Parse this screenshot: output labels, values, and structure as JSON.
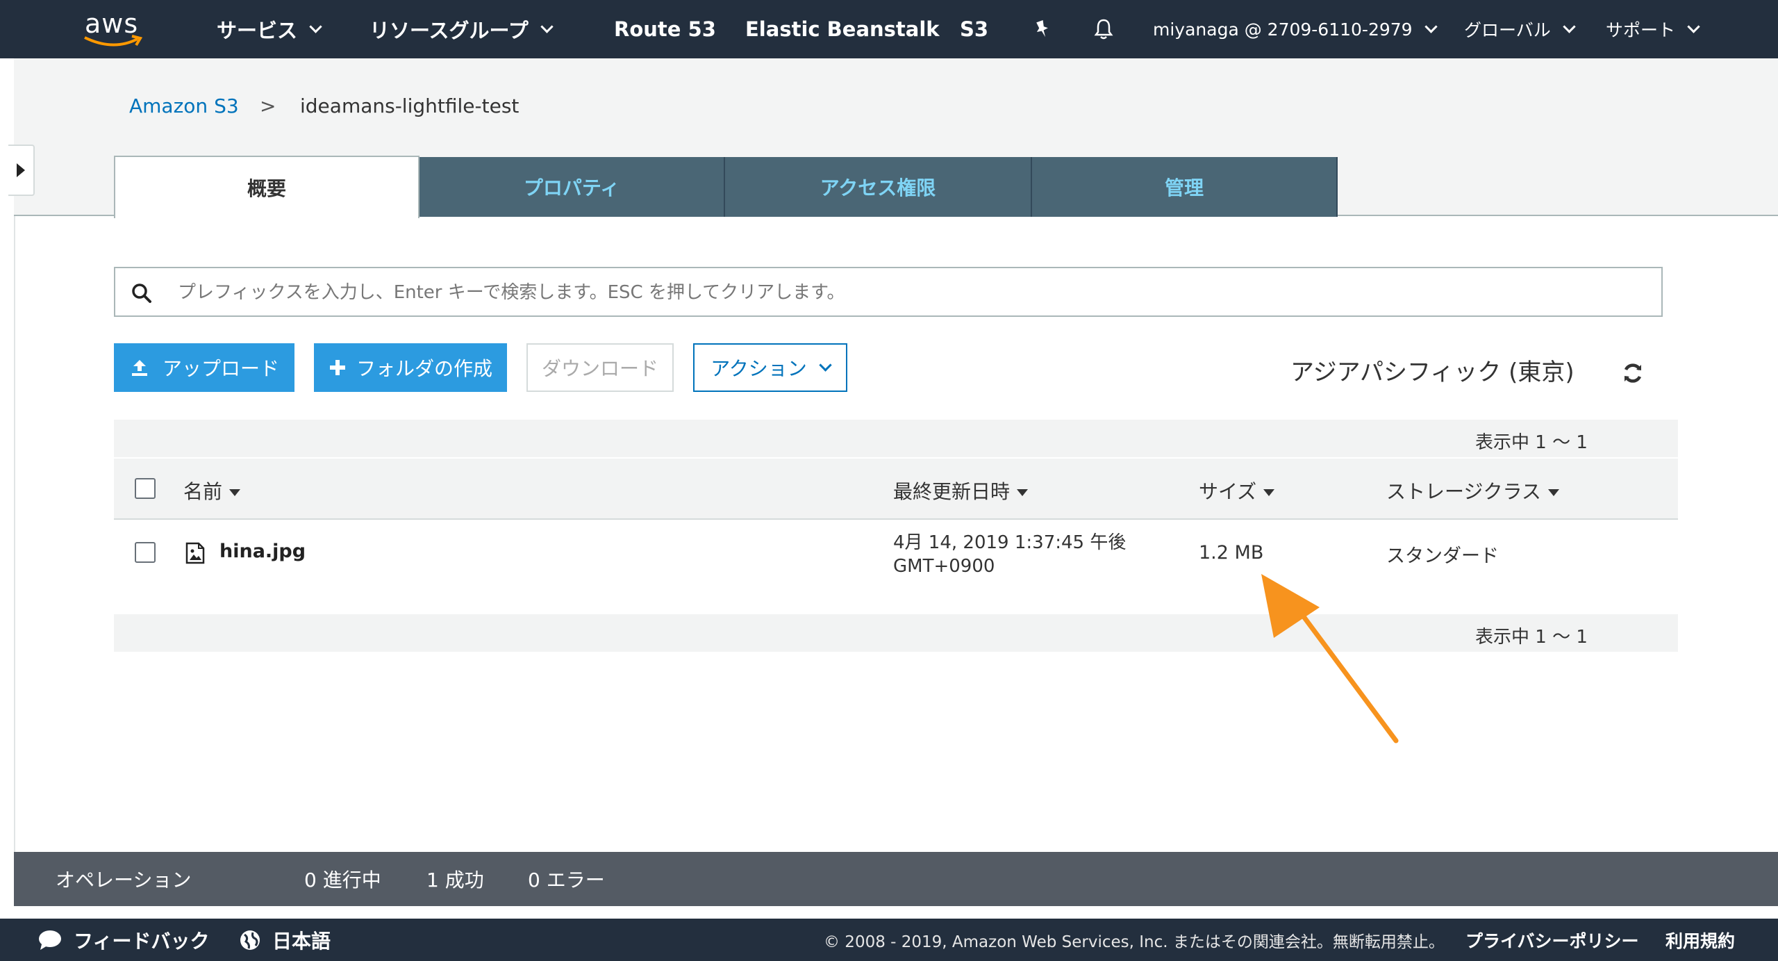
{
  "topnav": {
    "logo": "aws",
    "services": "サービス",
    "resource_groups": "リソースグループ",
    "route53": "Route 53",
    "beanstalk": "Elastic Beanstalk",
    "s3": "S3",
    "account": "miyanaga @ 2709-6110-2979",
    "region": "グローバル",
    "support": "サポート"
  },
  "breadcrumb": {
    "root": "Amazon S3",
    "separator": ">",
    "bucket": "ideamans-lightfile-test"
  },
  "tabs": [
    {
      "label": "概要"
    },
    {
      "label": "プロパティ"
    },
    {
      "label": "アクセス権限"
    },
    {
      "label": "管理"
    }
  ],
  "search": {
    "placeholder": "プレフィックスを入力し、Enter キーで検索します。ESC を押してクリアします。"
  },
  "toolbar": {
    "upload": "アップロード",
    "create_folder": "フォルダの作成",
    "download": "ダウンロード",
    "actions": "アクション",
    "region": "アジアパシフィック (東京)"
  },
  "pager": {
    "top": "表示中 1 〜 1",
    "bottom": "表示中 1 〜 1"
  },
  "table": {
    "columns": [
      "名前",
      "最終更新日時",
      "サイズ",
      "ストレージクラス"
    ],
    "rows": [
      {
        "name": "hina.jpg",
        "modified_line1": "4月 14, 2019 1:37:45 午後",
        "modified_line2": "GMT+0900",
        "size": "1.2 MB",
        "storage_class": "スタンダード"
      }
    ]
  },
  "operations": {
    "label": "オペレーション",
    "in_progress": "0 進行中",
    "success": "1 成功",
    "errors": "0 エラー"
  },
  "footer": {
    "feedback": "フィードバック",
    "language": "日本語",
    "copyright": "© 2008 - 2019, Amazon Web Services, Inc. またはその関連会社。無断転用禁止。",
    "privacy": "プライバシーポリシー",
    "terms": "利用規約"
  },
  "colors": {
    "nav_bg": "#232f3e",
    "primary": "#2c9be0",
    "link": "#0073bb",
    "tab_inactive": "#4a6675",
    "tab_text": "#7fd4f5",
    "annotation_arrow": "#f7931e"
  }
}
